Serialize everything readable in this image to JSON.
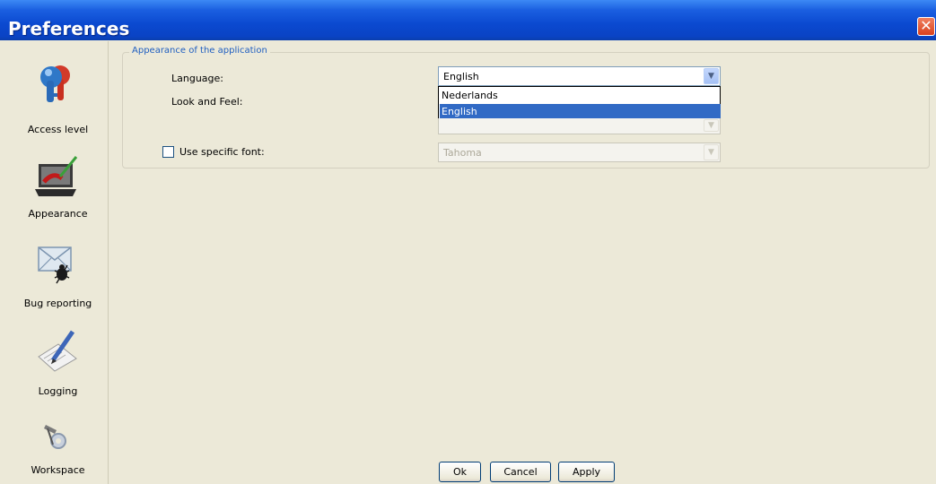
{
  "window": {
    "title": "Preferences",
    "close_glyph": "✕"
  },
  "sidebar": {
    "items": [
      {
        "label": "Access level",
        "icon": "access-level-icon"
      },
      {
        "label": "Appearance",
        "icon": "appearance-icon"
      },
      {
        "label": "Bug reporting",
        "icon": "bug-reporting-icon"
      },
      {
        "label": "Logging",
        "icon": "logging-icon"
      },
      {
        "label": "Workspace",
        "icon": "workspace-icon"
      }
    ]
  },
  "appearance": {
    "group_title": "Appearance of the application",
    "language": {
      "label": "Language:",
      "value": "English",
      "options": [
        "Nederlands",
        "English"
      ],
      "selected_index": 1,
      "expanded": true
    },
    "look_and_feel": {
      "label": "Look and Feel:",
      "value": ""
    },
    "specific_font": {
      "label": "Use specific font:",
      "checked": false,
      "value": "Tahoma"
    }
  },
  "buttons": {
    "ok": "Ok",
    "cancel": "Cancel",
    "apply": "Apply"
  },
  "colors": {
    "titlebar": "#0b49d0",
    "window_bg": "#ece9d8",
    "selection": "#316ac5",
    "group_title": "#1f5ec0"
  }
}
